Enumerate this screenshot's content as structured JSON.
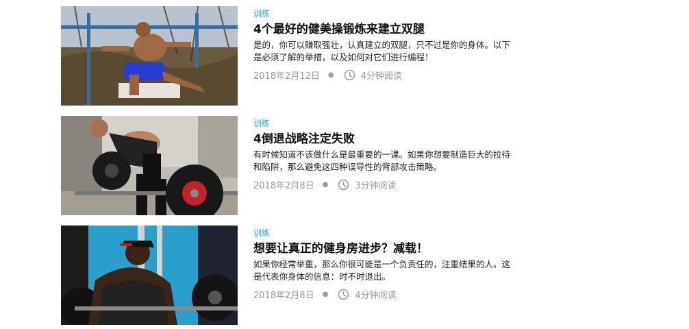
{
  "articles": [
    {
      "category": "训练",
      "title": "4个最好的健美操锻炼来建立双腿",
      "excerpt": "是的，你可以赚取强壮，认真建立的双腿，只不过是你的身体。以下是必须了解的举措，以及如何对它们进行编程！",
      "date": "2018年2月12日",
      "read_time": "4分钟阅读",
      "image": "man-doing-pistol-squat-on-bars-photo"
    },
    {
      "category": "训练",
      "title": "4倒退战略注定失败",
      "excerpt": "有时候知道不该做什么是最重要的一课。如果你想要制造巨大的拉待和陷阱，那么避免这四种误导性的背部攻击策略。",
      "date": "2018年2月8日",
      "read_time": "3分钟阅读",
      "image": "man-doing-barbell-row-photo"
    },
    {
      "category": "训练",
      "title": "想要让真正的健身房进步？减载！",
      "excerpt": "如果你经常举重，那么你很可能是一个负责任的，注重结果的人。这是代表你身体的信息：时不时退出。",
      "date": "2018年2月8日",
      "read_time": "4分钟阅读",
      "image": "man-resting-on-barbell-in-gym-photo"
    }
  ],
  "colors": {
    "category": "#2aa3d6",
    "title": "#111111",
    "meta": "#9a9a9a"
  },
  "icons": {
    "meta_separator": "bullet",
    "read_time": "clock-icon"
  }
}
